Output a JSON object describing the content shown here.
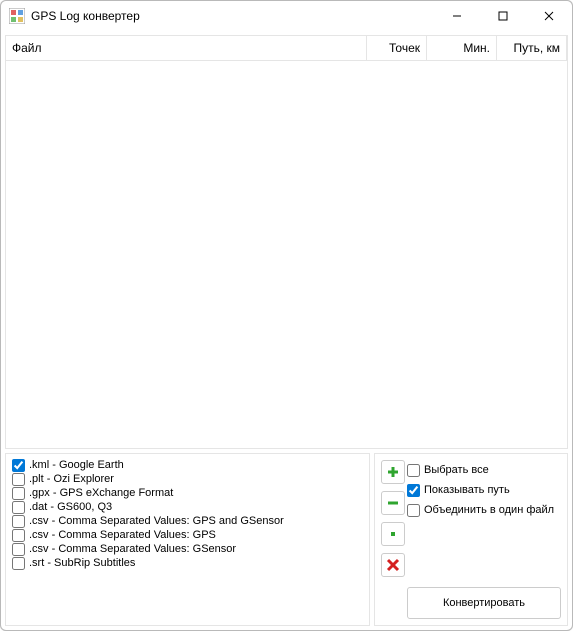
{
  "window": {
    "title": "GPS Log конвертер"
  },
  "columns": {
    "file": "Файл",
    "points": "Точек",
    "minutes": "Мин.",
    "distance": "Путь, км"
  },
  "formats": [
    {
      "label": ".kml - Google Earth",
      "checked": true
    },
    {
      "label": ".plt - Ozi Explorer",
      "checked": false
    },
    {
      "label": ".gpx - GPS eXchange Format",
      "checked": false
    },
    {
      "label": ".dat - GS600, Q3",
      "checked": false
    },
    {
      "label": ".csv - Comma Separated Values: GPS and GSensor",
      "checked": false
    },
    {
      "label": ".csv - Comma Separated Values: GPS",
      "checked": false
    },
    {
      "label": ".csv - Comma Separated Values: GSensor",
      "checked": false
    },
    {
      "label": ".srt - SubRip Subtitles",
      "checked": false
    }
  ],
  "options": {
    "select_all": {
      "label": "Выбрать все",
      "checked": false
    },
    "show_path": {
      "label": "Показывать путь",
      "checked": true
    },
    "merge": {
      "label": "Объединить в один файл",
      "checked": false
    }
  },
  "buttons": {
    "convert": "Конвертировать"
  },
  "icons": {
    "add": "plus-icon",
    "remove": "minus-icon",
    "clear": "dot-icon",
    "delete": "x-icon"
  },
  "colors": {
    "accent": "#0078d7",
    "add": "#2fa52f",
    "remove": "#2fa52f",
    "dot": "#2fa52f",
    "delete": "#d42020"
  }
}
